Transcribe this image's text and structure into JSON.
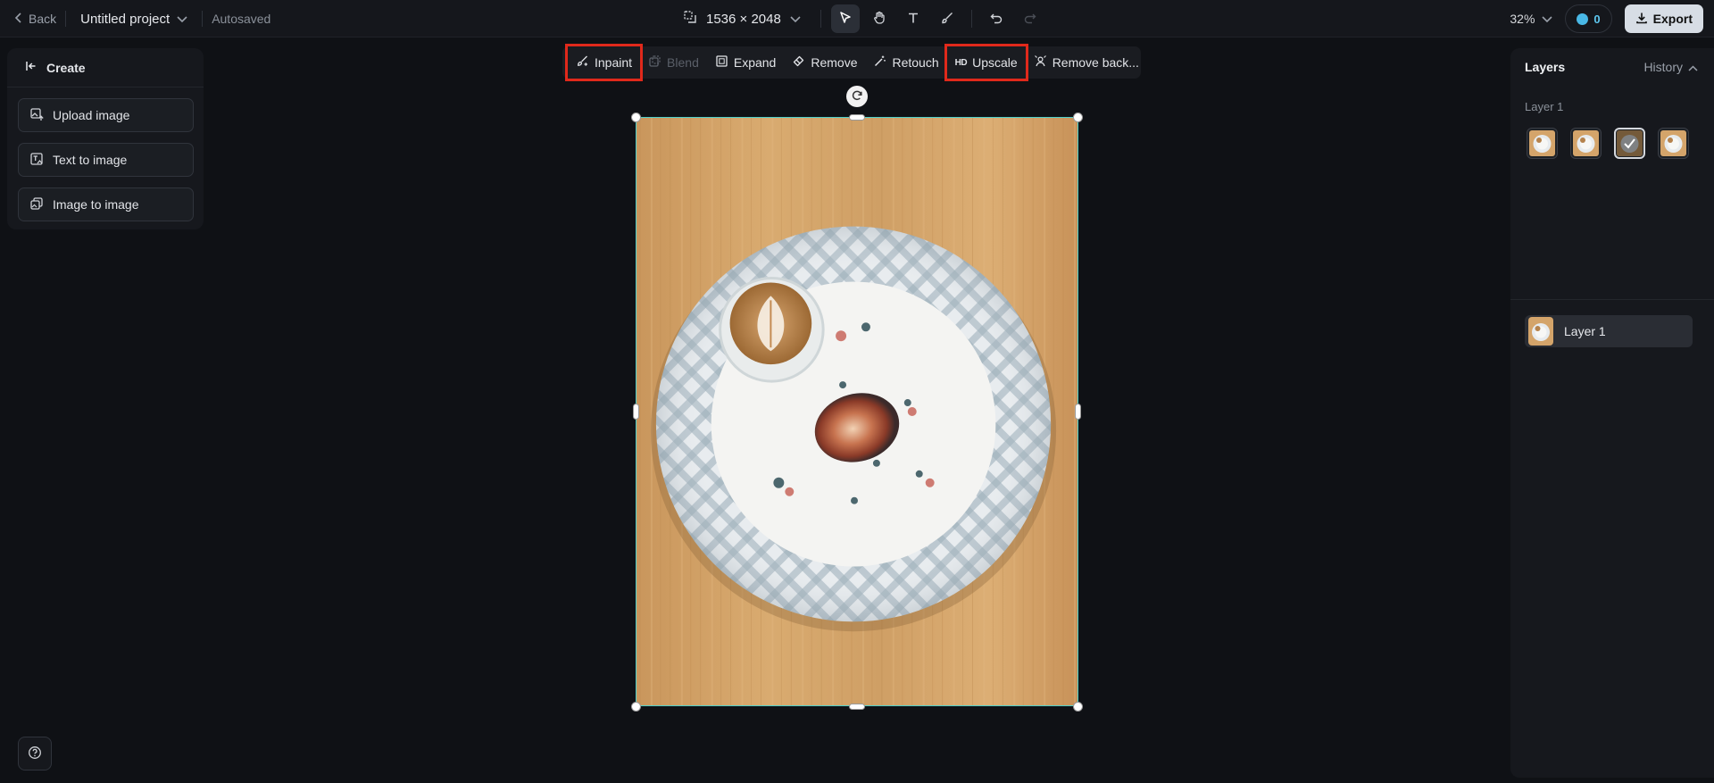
{
  "topbar": {
    "back_label": "Back",
    "project_name": "Untitled project",
    "autosave_status": "Autosaved",
    "canvas_size": "1536 × 2048",
    "zoom": "32%",
    "credits": "0",
    "export_label": "Export"
  },
  "tools": {
    "icons": [
      "select-icon",
      "hand-icon",
      "text-icon",
      "brush-icon",
      "undo-icon",
      "redo-icon"
    ],
    "active": "select-icon"
  },
  "left_panel": {
    "header": "Create",
    "items": [
      {
        "label": "Upload image",
        "icon": "upload-image-icon"
      },
      {
        "label": "Text to image",
        "icon": "text-to-image-icon"
      },
      {
        "label": "Image to image",
        "icon": "image-to-image-icon"
      }
    ]
  },
  "edit_toolbar": {
    "items": [
      {
        "label": "Inpaint",
        "icon": "inpaint-icon",
        "highlighted": true,
        "disabled": false
      },
      {
        "label": "Blend",
        "icon": "blend-icon",
        "highlighted": false,
        "disabled": true
      },
      {
        "label": "Expand",
        "icon": "expand-icon",
        "highlighted": false,
        "disabled": false
      },
      {
        "label": "Remove",
        "icon": "eraser-icon",
        "highlighted": false,
        "disabled": false
      },
      {
        "label": "Retouch",
        "icon": "retouch-icon",
        "highlighted": false,
        "disabled": false
      },
      {
        "label": "Upscale",
        "icon": "hd-icon",
        "icon_text": "HD",
        "highlighted": true,
        "disabled": false
      },
      {
        "label": "Remove back...",
        "icon": "remove-background-icon",
        "highlighted": false,
        "disabled": false
      }
    ],
    "highlight_color": "#e0291b"
  },
  "right_panel": {
    "title": "Layers",
    "history_label": "History",
    "variants_title": "Layer 1",
    "variant_count": 4,
    "selected_variant": 3,
    "layers": [
      {
        "name": "Layer 1"
      }
    ]
  },
  "colors": {
    "selection": "#4fd0c9",
    "accent": "#49b8e6"
  }
}
